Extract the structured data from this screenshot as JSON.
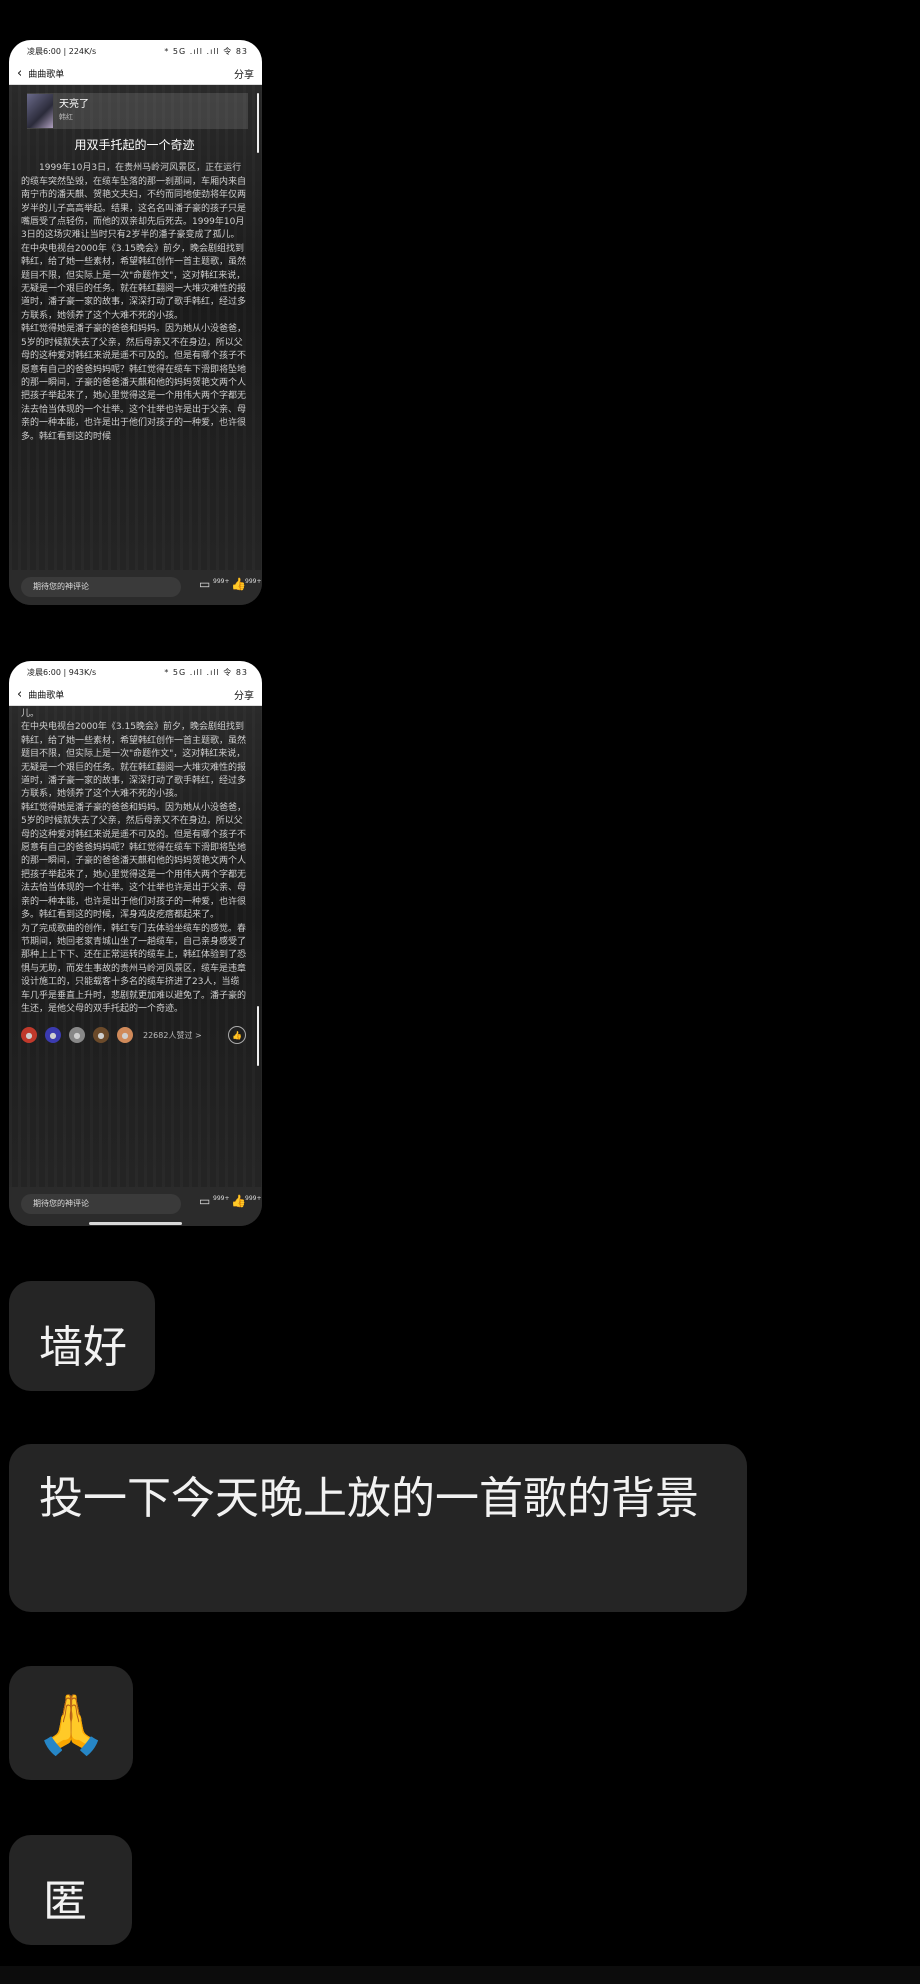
{
  "phone1": {
    "status_left": "凌晨6:00 | 224K/s",
    "status_right": "* 5G .ıll .ıll 令 83",
    "back_label": "曲曲歌单",
    "share_label": "分享",
    "song_title": "天亮了",
    "song_artist": "韩红",
    "article_title": "用双手托起的一个奇迹",
    "paragraphs": [
      "1999年10月3日，在贵州马岭河风景区，正在运行的缆车突然坠毁，在缆车坠落的那一刹那间，车厢内来自南宁市的潘天麒、贺艳文夫妇，不约而同地使劲将年仅两岁半的儿子高高举起。结果，这名名叫潘子豪的孩子只是嘴唇受了点轻伤，而他的双亲却先后死去。1999年10月3日的这场灾难让当时只有2岁半的潘子豪变成了孤儿。",
      "在中央电视台2000年《3.15晚会》前夕，晚会剧组找到韩红，给了她一些素材，希望韩红创作一首主题歌，虽然题目不限，但实际上是一次\"命题作文\"，这对韩红来说，无疑是一个艰巨的任务。就在韩红翻阅一大堆灾难性的报道时，潘子豪一家的故事，深深打动了歌手韩红，经过多方联系，她领养了这个大难不死的小孩。",
      "韩红觉得她是潘子豪的爸爸和妈妈。因为她从小没爸爸，5岁的时候就失去了父亲，然后母亲又不在身边，所以父母的这种爱对韩红来说是遥不可及的。但是有哪个孩子不愿意有自己的爸爸妈妈呢？韩红觉得在缆车下滑即将坠地的那一瞬间，子豪的爸爸潘天麒和他的妈妈贺艳文两个人把孩子举起来了，她心里觉得这是一个用伟大两个字都无法去恰当体现的一个壮举。这个壮举也许是出于父亲、母亲的一种本能，也许是出于他们对孩子的一种爱，也许很多。韩红看到这的时候"
    ],
    "comment_placeholder": "期待您的神评论",
    "comment_count": "999+",
    "like_count": "999+"
  },
  "phone2": {
    "status_left": "凌晨6:00 | 943K/s",
    "status_right": "* 5G .ıll .ıll 令 83",
    "back_label": "曲曲歌单",
    "share_label": "分享",
    "top_fragment": "儿。",
    "paragraphs": [
      "在中央电视台2000年《3.15晚会》前夕，晚会剧组找到韩红，给了她一些素材，希望韩红创作一首主题歌，虽然题目不限，但实际上是一次\"命题作文\"，这对韩红来说，无疑是一个艰巨的任务。就在韩红翻阅一大堆灾难性的报道时，潘子豪一家的故事，深深打动了歌手韩红，经过多方联系，她领养了这个大难不死的小孩。",
      "韩红觉得她是潘子豪的爸爸和妈妈。因为她从小没爸爸，5岁的时候就失去了父亲，然后母亲又不在身边，所以父母的这种爱对韩红来说是遥不可及的。但是有哪个孩子不愿意有自己的爸爸妈妈呢？韩红觉得在缆车下滑即将坠地的那一瞬间，子豪的爸爸潘天麒和他的妈妈贺艳文两个人把孩子举起来了，她心里觉得这是一个用伟大两个字都无法去恰当体现的一个壮举。这个壮举也许是出于父亲、母亲的一种本能，也许是出于他们对孩子的一种爱，也许很多。韩红看到这的时候，浑身鸡皮疙瘩都起来了。",
      "为了完成歌曲的创作，韩红专门去体验坐缆车的感觉。春节期间，她回老家青城山坐了一趟缆车，自己亲身感受了那种上上下下、还在正常运转的缆车上，韩红体验到了恐惧与无助，而发生事故的贵州马岭河风景区，缆车是违章设计施工的，只能载客十多名的缆车挤进了23人，当缆车几乎是垂直上升时，悲剧就更加难以避免了。潘子豪的生还，是他父母的双手托起的一个奇迹。"
    ],
    "likes_text": "22682人赞过 >",
    "comment_placeholder": "期待您的神评论",
    "comment_count": "999+",
    "like_count": "999+"
  },
  "chat": {
    "msg1": "墙好",
    "msg2": "投一下今天晚上放的一首歌的背景",
    "msg3": "🙏",
    "msg4": "匿"
  },
  "colors": {
    "background": "#000000",
    "bubble": "#252525",
    "bubble_text": "#f2f2f2"
  }
}
